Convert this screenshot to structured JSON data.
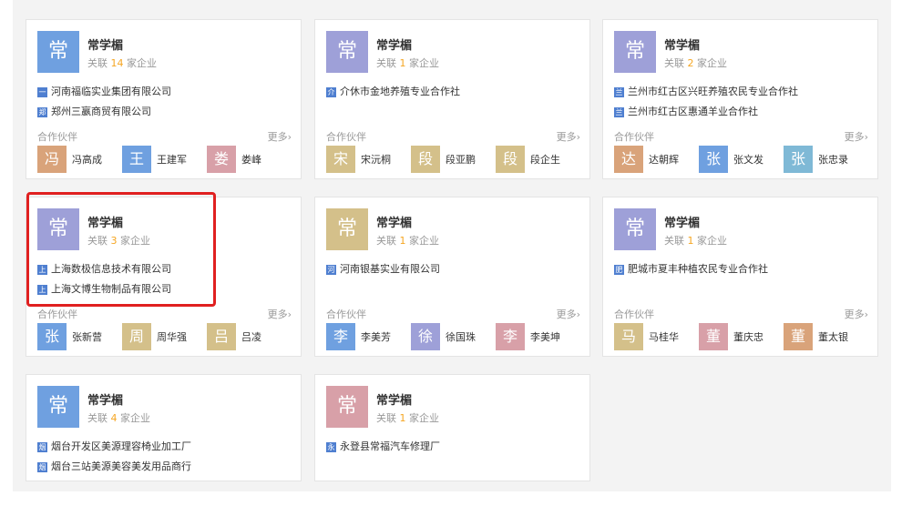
{
  "more_label": "更多",
  "partners_label": "合作伙伴",
  "assoc_prefix": "关联",
  "assoc_suffix": "家企业",
  "colors": {
    "purple": "#9ea0d8",
    "blue": "#6fa0e0",
    "tan": "#d4c08a",
    "pink": "#d8a0a8",
    "orange": "#d9a37a",
    "teal": "#7fb9d6",
    "count": "#f5a623",
    "highlight": "#e02020"
  },
  "cards": [
    {
      "avatar": "常",
      "name": "常学楣",
      "count": "14",
      "companies": [
        {
          "icon": "一",
          "text": "河南福临实业集团有限公司"
        },
        {
          "icon": "郑",
          "text": "郑州三嬴商贸有限公司"
        }
      ],
      "partners": [
        {
          "avatar": "冯",
          "name": "冯高成"
        },
        {
          "avatar": "王",
          "name": "王建军"
        },
        {
          "avatar": "娄",
          "name": "娄峰"
        }
      ]
    },
    {
      "avatar": "常",
      "name": "常学楣",
      "count": "1",
      "companies": [
        {
          "icon": "介",
          "text": "介休市金地养殖专业合作社"
        }
      ],
      "partners": [
        {
          "avatar": "宋",
          "name": "宋沅桐"
        },
        {
          "avatar": "段",
          "name": "段亚鹏"
        },
        {
          "avatar": "段",
          "name": "段企生"
        }
      ]
    },
    {
      "avatar": "常",
      "name": "常学楣",
      "count": "2",
      "companies": [
        {
          "icon": "兰",
          "text": "兰州市红古区兴旺养殖农民专业合作社"
        },
        {
          "icon": "兰",
          "text": "兰州市红古区惠通羊业合作社"
        }
      ],
      "partners": [
        {
          "avatar": "达",
          "name": "达朝辉"
        },
        {
          "avatar": "张",
          "name": "张文发"
        },
        {
          "avatar": "张",
          "name": "张忠录"
        }
      ]
    },
    {
      "avatar": "常",
      "name": "常学楣",
      "count": "3",
      "companies": [
        {
          "icon": "上",
          "text": "上海数极信息技术有限公司"
        },
        {
          "icon": "上",
          "text": "上海文博生物制品有限公司"
        }
      ],
      "partners": [
        {
          "avatar": "张",
          "name": "张新营"
        },
        {
          "avatar": "周",
          "name": "周华强"
        },
        {
          "avatar": "吕",
          "name": "吕凌"
        }
      ]
    },
    {
      "avatar": "常",
      "name": "常学楣",
      "count": "1",
      "companies": [
        {
          "icon": "河",
          "text": "河南银基实业有限公司"
        }
      ],
      "partners": [
        {
          "avatar": "李",
          "name": "李美芳"
        },
        {
          "avatar": "徐",
          "name": "徐国珠"
        },
        {
          "avatar": "李",
          "name": "李美坤"
        }
      ]
    },
    {
      "avatar": "常",
      "name": "常学楣",
      "count": "1",
      "companies": [
        {
          "icon": "肥",
          "text": "肥城市夏丰种植农民专业合作社"
        }
      ],
      "partners": [
        {
          "avatar": "马",
          "name": "马桂华"
        },
        {
          "avatar": "董",
          "name": "董庆忠"
        },
        {
          "avatar": "董",
          "name": "董太银"
        }
      ]
    },
    {
      "avatar": "常",
      "name": "常学楣",
      "count": "4",
      "companies": [
        {
          "icon": "烟",
          "text": "烟台开发区美源理容椅业加工厂"
        },
        {
          "icon": "烟",
          "text": "烟台三站美源美容美发用品商行"
        }
      ],
      "partners": []
    },
    {
      "avatar": "常",
      "name": "常学楣",
      "count": "1",
      "companies": [
        {
          "icon": "永",
          "text": "永登县常福汽车修理厂"
        }
      ],
      "partners": []
    }
  ]
}
